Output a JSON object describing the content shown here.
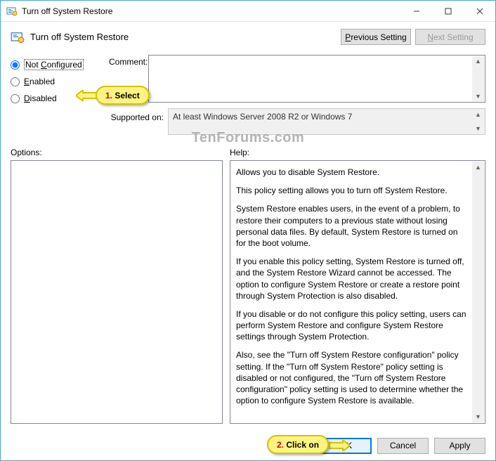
{
  "window": {
    "title": "Turn off System Restore",
    "header_title": "Turn off System Restore"
  },
  "nav": {
    "previous": "Previous Setting",
    "next": "Next Setting"
  },
  "radios": {
    "not_configured": "Not Configured",
    "enabled": "Enabled",
    "disabled": "Disabled"
  },
  "labels": {
    "comment": "Comment:",
    "supported_on": "Supported on:",
    "options": "Options:",
    "help": "Help:"
  },
  "supported_text": "At least Windows Server 2008 R2 or Windows 7",
  "help": {
    "p1": "Allows you to disable System Restore.",
    "p2": "This policy setting allows you to turn off System Restore.",
    "p3": "System Restore enables users, in the event of a problem, to restore their computers to a previous state without losing personal data files. By default, System Restore is turned on for the boot volume.",
    "p4": "If you enable this policy setting, System Restore is turned off, and the System Restore Wizard cannot be accessed. The option to configure System Restore or create a restore point through System Protection is also disabled.",
    "p5": "If you disable or do not configure this policy setting, users can perform System Restore and configure System Restore settings through System Protection.",
    "p6": "Also, see the \"Turn off System Restore configuration\" policy setting. If the \"Turn off System Restore\" policy setting is disabled or not configured, the \"Turn off System Restore configuration\" policy setting is used to determine whether the option to configure System Restore is available."
  },
  "buttons": {
    "ok": "OK",
    "cancel": "Cancel",
    "apply": "Apply"
  },
  "callouts": {
    "c1_num": "1.",
    "c1_text": " Select",
    "c2_num": "2.",
    "c2_text": " Click on"
  },
  "watermark": "TenForums.com"
}
